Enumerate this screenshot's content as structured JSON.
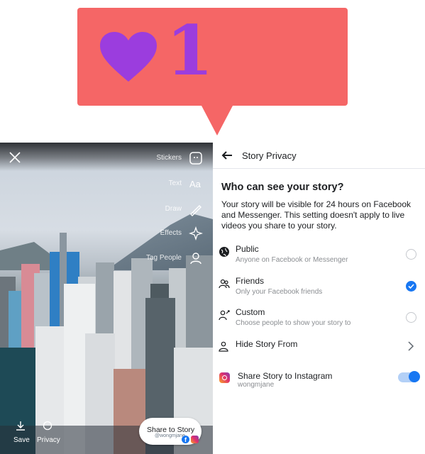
{
  "notification": {
    "count": "1",
    "icon": "heart-icon",
    "bubble_color": "#f56666",
    "accent_color": "#9b3dde"
  },
  "story_camera": {
    "tools": [
      {
        "label": "Stickers",
        "icon": "sticker-icon"
      },
      {
        "label": "Text",
        "icon": "text-icon"
      },
      {
        "label": "Draw",
        "icon": "draw-icon"
      },
      {
        "label": "Effects",
        "icon": "effects-icon"
      },
      {
        "label": "Tag People",
        "icon": "tag-people-icon"
      }
    ],
    "bottom": {
      "save_label": "Save",
      "privacy_label": "Privacy"
    },
    "share_button": {
      "label": "Share to Story",
      "account": "@wongmjane"
    }
  },
  "privacy": {
    "title": "Story Privacy",
    "question": "Who can see your story?",
    "description": "Your story will be visible for 24 hours on Facebook and Messenger. This setting doesn't apply to live videos you share to your story.",
    "options": [
      {
        "title": "Public",
        "subtitle": "Anyone on Facebook or Messenger",
        "icon": "globe-icon",
        "selected": false
      },
      {
        "title": "Friends",
        "subtitle": "Only your Facebook friends",
        "icon": "friends-icon",
        "selected": true
      },
      {
        "title": "Custom",
        "subtitle": "Choose people to show your story to",
        "icon": "custom-icon",
        "selected": false
      }
    ],
    "hide_story": {
      "title": "Hide Story From",
      "icon": "person-icon"
    },
    "instagram": {
      "title": "Share Story to Instagram",
      "subtitle": "wongmjane",
      "enabled": true,
      "toggle_color": "#1877f2"
    }
  }
}
